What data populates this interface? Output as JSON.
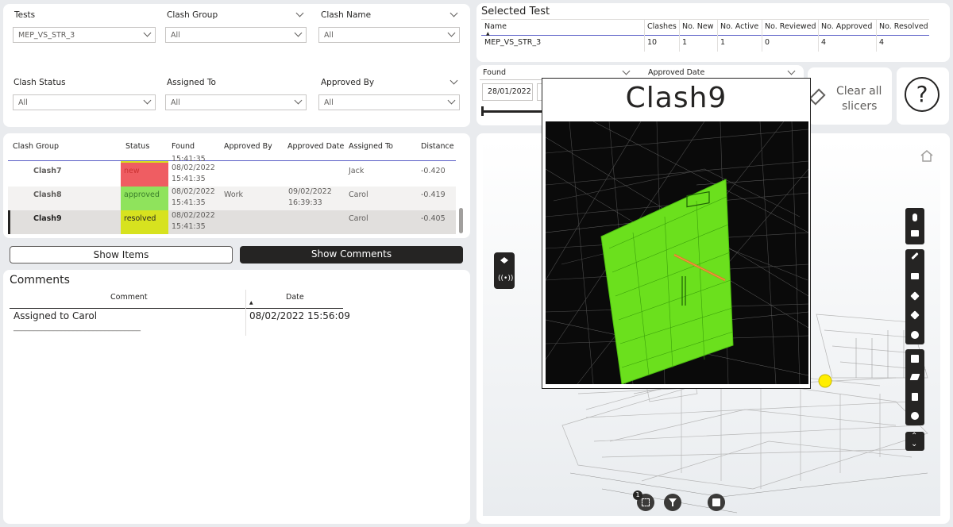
{
  "filters": {
    "tests": {
      "label": "Tests",
      "value": "MEP_VS_STR_3"
    },
    "clash_group": {
      "label": "Clash Group",
      "value": "All"
    },
    "clash_name": {
      "label": "Clash Name",
      "value": "All"
    },
    "clash_status": {
      "label": "Clash Status",
      "value": "All"
    },
    "assigned_to": {
      "label": "Assigned To",
      "value": "All"
    },
    "approved_by": {
      "label": "Approved By",
      "value": "All"
    }
  },
  "selected_test": {
    "title": "Selected Test",
    "columns": [
      "Name",
      "Clashes",
      "No. New",
      "No. Active",
      "No. Reviewed",
      "No. Approved",
      "No. Resolved"
    ],
    "row": [
      "MEP_VS_STR_3",
      "10",
      "1",
      "1",
      "0",
      "4",
      "4"
    ]
  },
  "date_slicers": {
    "found": {
      "label": "Found",
      "value": "28/01/2022"
    },
    "approved": {
      "label": "Approved Date"
    }
  },
  "clear_slicers": {
    "line1": "Clear all",
    "line2": "slicers"
  },
  "help": {
    "symbol": "?"
  },
  "clash_table": {
    "columns": [
      "Clash Group",
      "Status",
      "Found",
      "Approved By",
      "Approved Date",
      "Assigned To",
      "Distance"
    ],
    "partial_top": "15:41:35",
    "rows": [
      {
        "group": "Clash7",
        "status": "new",
        "status_color": "#ef5d62",
        "found1": "08/02/2022",
        "found2": "15:41:35",
        "approved_by": "",
        "approved_date1": "",
        "approved_date2": "",
        "assigned": "Jack",
        "distance": "-0.420"
      },
      {
        "group": "Clash8",
        "status": "approved",
        "status_color": "#8fe35c",
        "found1": "08/02/2022",
        "found2": "15:41:35",
        "approved_by": "Work",
        "approved_date1": "09/02/2022",
        "approved_date2": "16:39:33",
        "assigned": "Carol",
        "distance": "-0.419"
      },
      {
        "group": "Clash9",
        "status": "resolved",
        "status_color": "#d7e21f",
        "found1": "08/02/2022",
        "found2": "15:41:35",
        "approved_by": "",
        "approved_date1": "",
        "approved_date2": "",
        "assigned": "Carol",
        "distance": "-0.405"
      }
    ]
  },
  "buttons": {
    "show_items": "Show Items",
    "show_comments": "Show Comments"
  },
  "comments": {
    "title": "Comments",
    "col_comment": "Comment",
    "col_date": "Date",
    "comment": "Assigned to Carol",
    "comment_tail": "________________________________",
    "date": "08/02/2022 15:56:09"
  },
  "popup": {
    "title": "Clash9"
  },
  "viewer": {
    "badge": "1"
  }
}
